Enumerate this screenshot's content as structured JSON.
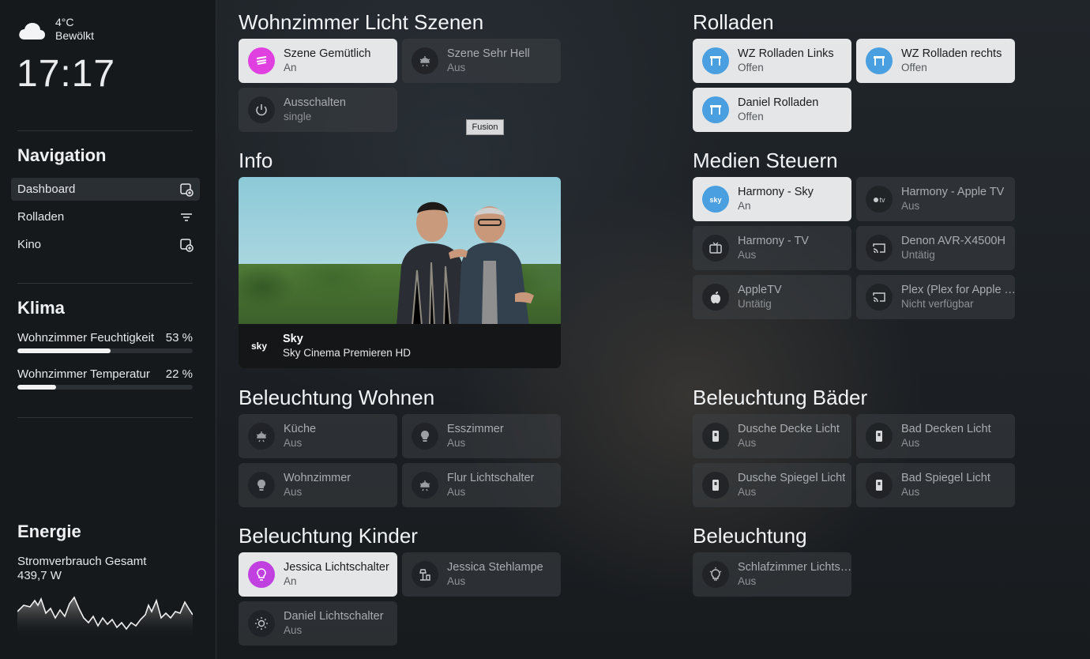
{
  "sidebar": {
    "weather": {
      "temp": "4°C",
      "condition": "Bewölkt",
      "icon": "cloud-icon"
    },
    "clock": "17:17",
    "navigation": {
      "title": "Navigation",
      "items": [
        {
          "label": "Dashboard",
          "icon": "dashboard-add-icon",
          "active": true
        },
        {
          "label": "Rolladen",
          "icon": "filter-icon",
          "active": false
        },
        {
          "label": "Kino",
          "icon": "dashboard-add-icon",
          "active": false
        }
      ]
    },
    "klima": {
      "title": "Klima",
      "rows": [
        {
          "label": "Wohnzimmer Feuchtigkeit",
          "value": "53 %",
          "level": 0.53
        },
        {
          "label": "Wohnzimmer Temperatur",
          "value": "22 %",
          "level": 0.22
        }
      ]
    },
    "energie": {
      "title": "Energie",
      "label": "Stromverbrauch Gesamt",
      "value": "439,7 W"
    }
  },
  "tooltip": "Fusion",
  "sections": {
    "licht_szenen": {
      "title": "Wohnzimmer Licht Szenen",
      "tiles": [
        {
          "name": "Szene Gemütlich",
          "state": "An",
          "on": true,
          "icon": "scene-icon",
          "color": "#e040e0"
        },
        {
          "name": "Szene Sehr Hell",
          "state": "Aus",
          "on": false,
          "icon": "ceiling-light-icon"
        },
        {
          "name": "Ausschalten",
          "state": "single",
          "on": false,
          "icon": "power-icon"
        }
      ]
    },
    "info": {
      "title": "Info",
      "media": {
        "channel_logo": "sky",
        "title": "Sky",
        "subtitle": "Sky Cinema Premieren HD"
      }
    },
    "rolladen": {
      "title": "Rolladen",
      "tiles": [
        {
          "name": "WZ Rolladen Links",
          "state": "Offen",
          "on": true,
          "icon": "blinds-open-icon",
          "color": "#4a9fe0"
        },
        {
          "name": "WZ Rolladen rechts",
          "state": "Offen",
          "on": true,
          "icon": "blinds-open-icon",
          "color": "#4a9fe0"
        },
        {
          "name": "Daniel Rolladen",
          "state": "Offen",
          "on": true,
          "icon": "blinds-open-icon",
          "color": "#4a9fe0"
        }
      ]
    },
    "medien": {
      "title": "Medien Steuern",
      "tiles": [
        {
          "name": "Harmony - Sky",
          "state": "An",
          "on": true,
          "icon": "sky-icon",
          "color": "#4a9fe0"
        },
        {
          "name": "Harmony - Apple TV",
          "state": "Aus",
          "on": false,
          "icon": "apple-tv-icon"
        },
        {
          "name": "Harmony - TV",
          "state": "Aus",
          "on": false,
          "icon": "tv-icon"
        },
        {
          "name": "Denon AVR-X4500H",
          "state": "Untätig",
          "on": false,
          "icon": "cast-icon"
        },
        {
          "name": "AppleTV",
          "state": "Untätig",
          "on": false,
          "icon": "apple-icon"
        },
        {
          "name": "Plex (Plex for Apple TV)",
          "state": "Nicht verfügbar",
          "on": false,
          "icon": "cast-icon"
        }
      ]
    },
    "beleuchtung_wohnen": {
      "title": "Beleuchtung Wohnen",
      "tiles": [
        {
          "name": "Küche",
          "state": "Aus",
          "on": false,
          "icon": "ceiling-light-icon"
        },
        {
          "name": "Esszimmer",
          "state": "Aus",
          "on": false,
          "icon": "bulb-icon"
        },
        {
          "name": "Wohnzimmer",
          "state": "Aus",
          "on": false,
          "icon": "bulb-icon"
        },
        {
          "name": "Flur Lichtschalter",
          "state": "Aus",
          "on": false,
          "icon": "ceiling-light-icon"
        }
      ]
    },
    "beleuchtung_baeder": {
      "title": "Beleuchtung Bäder",
      "tiles": [
        {
          "name": "Dusche Decke Licht",
          "state": "Aus",
          "on": false,
          "icon": "switch-icon"
        },
        {
          "name": "Bad Decken Licht",
          "state": "Aus",
          "on": false,
          "icon": "switch-icon"
        },
        {
          "name": "Dusche Spiegel Licht",
          "state": "Aus",
          "on": false,
          "icon": "switch-icon"
        },
        {
          "name": "Bad Spiegel Licht",
          "state": "Aus",
          "on": false,
          "icon": "switch-icon"
        }
      ]
    },
    "beleuchtung_kinder": {
      "title": "Beleuchtung Kinder",
      "tiles": [
        {
          "name": "Jessica Lichtschalter",
          "state": "An",
          "on": true,
          "icon": "bulb-outline-icon",
          "color": "#c040e0"
        },
        {
          "name": "Jessica Stehlampe",
          "state": "Aus",
          "on": false,
          "icon": "floor-lamp-icon"
        },
        {
          "name": "Daniel Lichtschalter",
          "state": "Aus",
          "on": false,
          "icon": "light-on-icon"
        }
      ]
    },
    "beleuchtung": {
      "title": "Beleuchtung",
      "tiles": [
        {
          "name": "Schlafzimmer Lichtschalter",
          "state": "Aus",
          "on": false,
          "icon": "bulb-outline-icon"
        }
      ]
    }
  }
}
